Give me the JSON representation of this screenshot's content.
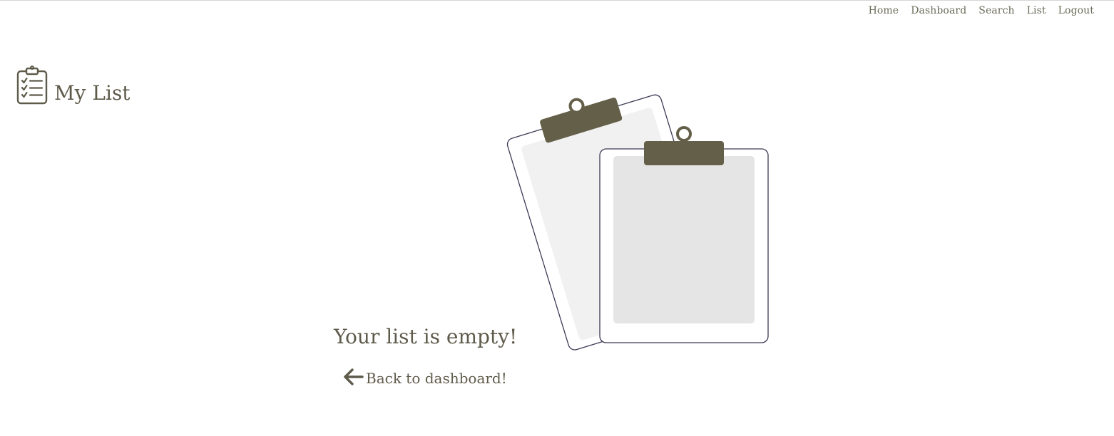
{
  "nav": {
    "items": [
      {
        "label": "Home"
      },
      {
        "label": "Dashboard"
      },
      {
        "label": "Search"
      },
      {
        "label": "List"
      },
      {
        "label": "Logout"
      }
    ]
  },
  "header": {
    "title": "My List",
    "icon": "clipboard-list-icon"
  },
  "empty_state": {
    "message": "Your list is empty!",
    "illustration": "empty-clipboards-illustration",
    "back_link_label": "Back to dashboard!",
    "back_icon": "arrow-left-icon"
  },
  "colors": {
    "accent": "#645f49",
    "text": "#5f5b4b",
    "nav_text": "#6b6b5a",
    "paper_light": "#f1f1f1",
    "paper_dark": "#e5e5e5",
    "outline": "#3d3a55"
  }
}
